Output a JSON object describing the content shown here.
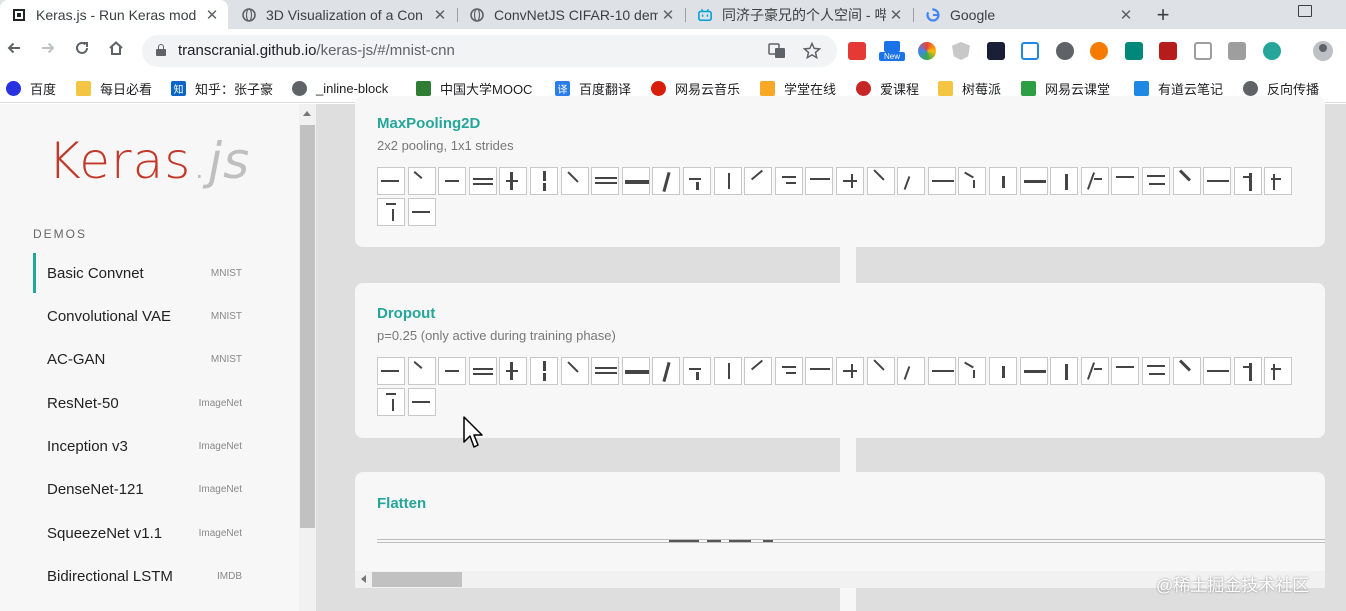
{
  "browser": {
    "tabs": [
      {
        "title": "Keras.js - Run Keras mod",
        "favicon": "keras-icon"
      },
      {
        "title": "3D Visualization of a Con",
        "favicon": "globe-icon"
      },
      {
        "title": "ConvNetJS CIFAR-10 dem",
        "favicon": "globe-icon"
      },
      {
        "title": "同济子豪兄的个人空间 - 哔",
        "favicon": "bilibili-icon"
      },
      {
        "title": "Google",
        "favicon": "google-icon"
      }
    ],
    "new_tab_symbol": "+",
    "url_host": "transcranial.github.io",
    "url_path": "/keras-js/#/mnist-cnn",
    "extension_new_label": "New"
  },
  "bookmarks": [
    {
      "label": "百度",
      "color": "#2932e1"
    },
    {
      "label": "每日必看",
      "color": "#f4c542"
    },
    {
      "label": "知乎：张子豪",
      "color": "#0a66c2"
    },
    {
      "label": "_inline-block",
      "color": "#5f6368"
    },
    {
      "label": "中国大学MOOC",
      "color": "#2e7d32"
    },
    {
      "label": "百度翻译",
      "color": "#2b7de9"
    },
    {
      "label": "网易云音乐",
      "color": "#d81e06"
    },
    {
      "label": "学堂在线",
      "color": "#f9a825"
    },
    {
      "label": "爱课程",
      "color": "#c62828"
    },
    {
      "label": "树莓派",
      "color": "#f4c542"
    },
    {
      "label": "网易云课堂",
      "color": "#2e9e44"
    },
    {
      "label": "有道云笔记",
      "color": "#1e88e5"
    },
    {
      "label": "反向传播",
      "color": "#5f6368"
    }
  ],
  "sidebar": {
    "logo_main": "Keras",
    "logo_dot": ".",
    "logo_js": "js",
    "section_title": "DEMOS",
    "items": [
      {
        "label": "Basic Convnet",
        "dataset": "MNIST",
        "active": true
      },
      {
        "label": "Convolutional VAE",
        "dataset": "MNIST",
        "active": false
      },
      {
        "label": "AC-GAN",
        "dataset": "MNIST",
        "active": false
      },
      {
        "label": "ResNet-50",
        "dataset": "ImageNet",
        "active": false
      },
      {
        "label": "Inception v3",
        "dataset": "ImageNet",
        "active": false
      },
      {
        "label": "DenseNet-121",
        "dataset": "ImageNet",
        "active": false
      },
      {
        "label": "SqueezeNet v1.1",
        "dataset": "ImageNet",
        "active": false
      },
      {
        "label": "Bidirectional LSTM",
        "dataset": "IMDB",
        "active": false
      }
    ]
  },
  "layers": [
    {
      "name": "MaxPooling2D",
      "description": "2x2 pooling, 1x1 strides",
      "feature_map_count": 32
    },
    {
      "name": "Dropout",
      "description": "p=0.25 (only active during training phase)",
      "feature_map_count": 32
    },
    {
      "name": "Flatten",
      "description": ""
    }
  ],
  "watermark": "@稀土掘金技术社区",
  "colors": {
    "accent": "#26a69a",
    "logo_red": "#c0392b",
    "main_bg": "#dedede",
    "card_bg": "#f7f7f7"
  }
}
